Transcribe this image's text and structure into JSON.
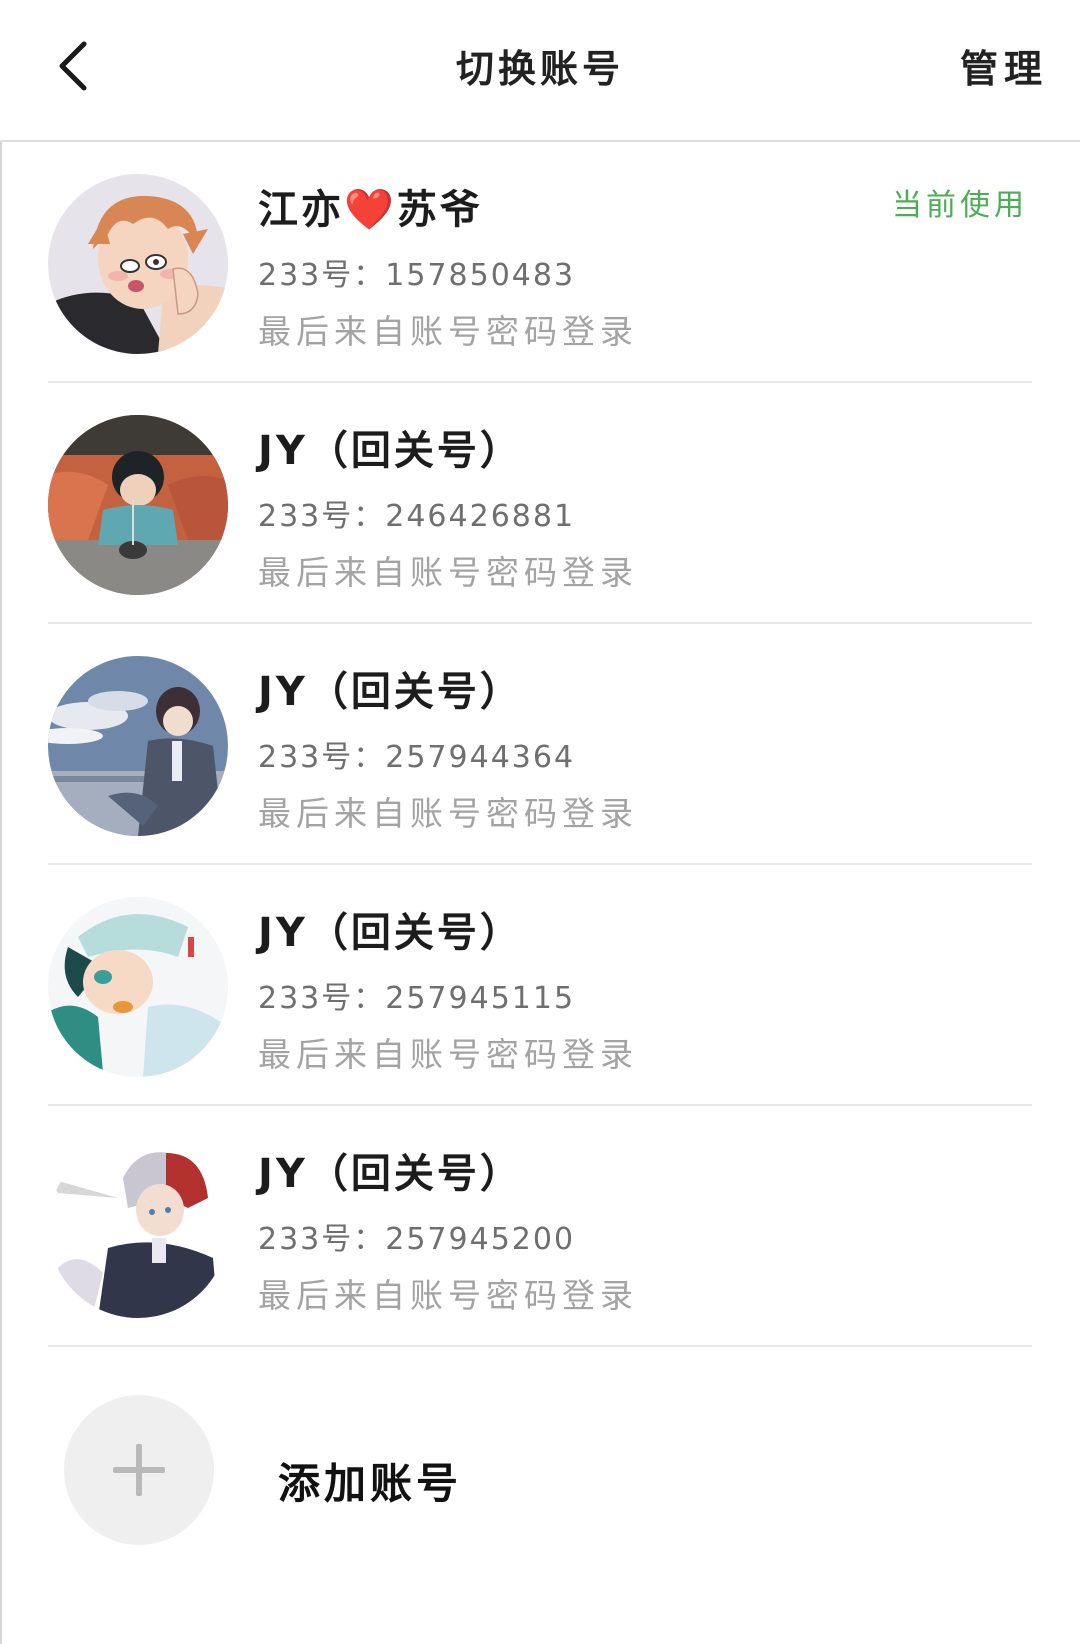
{
  "header": {
    "title": "切换账号",
    "manage_label": "管理",
    "back_icon": "chevron-left-icon"
  },
  "accounts": [
    {
      "name": "江亦❤️苏爷",
      "id_text": "233号：157850483",
      "login_text": "最后来自账号密码登录",
      "current_label": "当前使用",
      "is_current": true
    },
    {
      "name": "JY（回关号）",
      "id_text": "233号：246426881",
      "login_text": "最后来自账号密码登录",
      "is_current": false
    },
    {
      "name": "JY（回关号）",
      "id_text": "233号：257944364",
      "login_text": "最后来自账号密码登录",
      "is_current": false
    },
    {
      "name": "JY（回关号）",
      "id_text": "233号：257945115",
      "login_text": "最后来自账号密码登录",
      "is_current": false
    },
    {
      "name": "JY（回关号）",
      "id_text": "233号：257945200",
      "login_text": "最后来自账号密码登录",
      "is_current": false
    }
  ],
  "add_account": {
    "label": "添加账号",
    "icon": "plus-icon"
  },
  "colors": {
    "current_badge": "#4cad55",
    "secondary_text": "#6f6f6f",
    "tertiary_text": "#a3a3a3",
    "divider": "#e8e8e8",
    "add_circle_bg": "#efefef"
  }
}
